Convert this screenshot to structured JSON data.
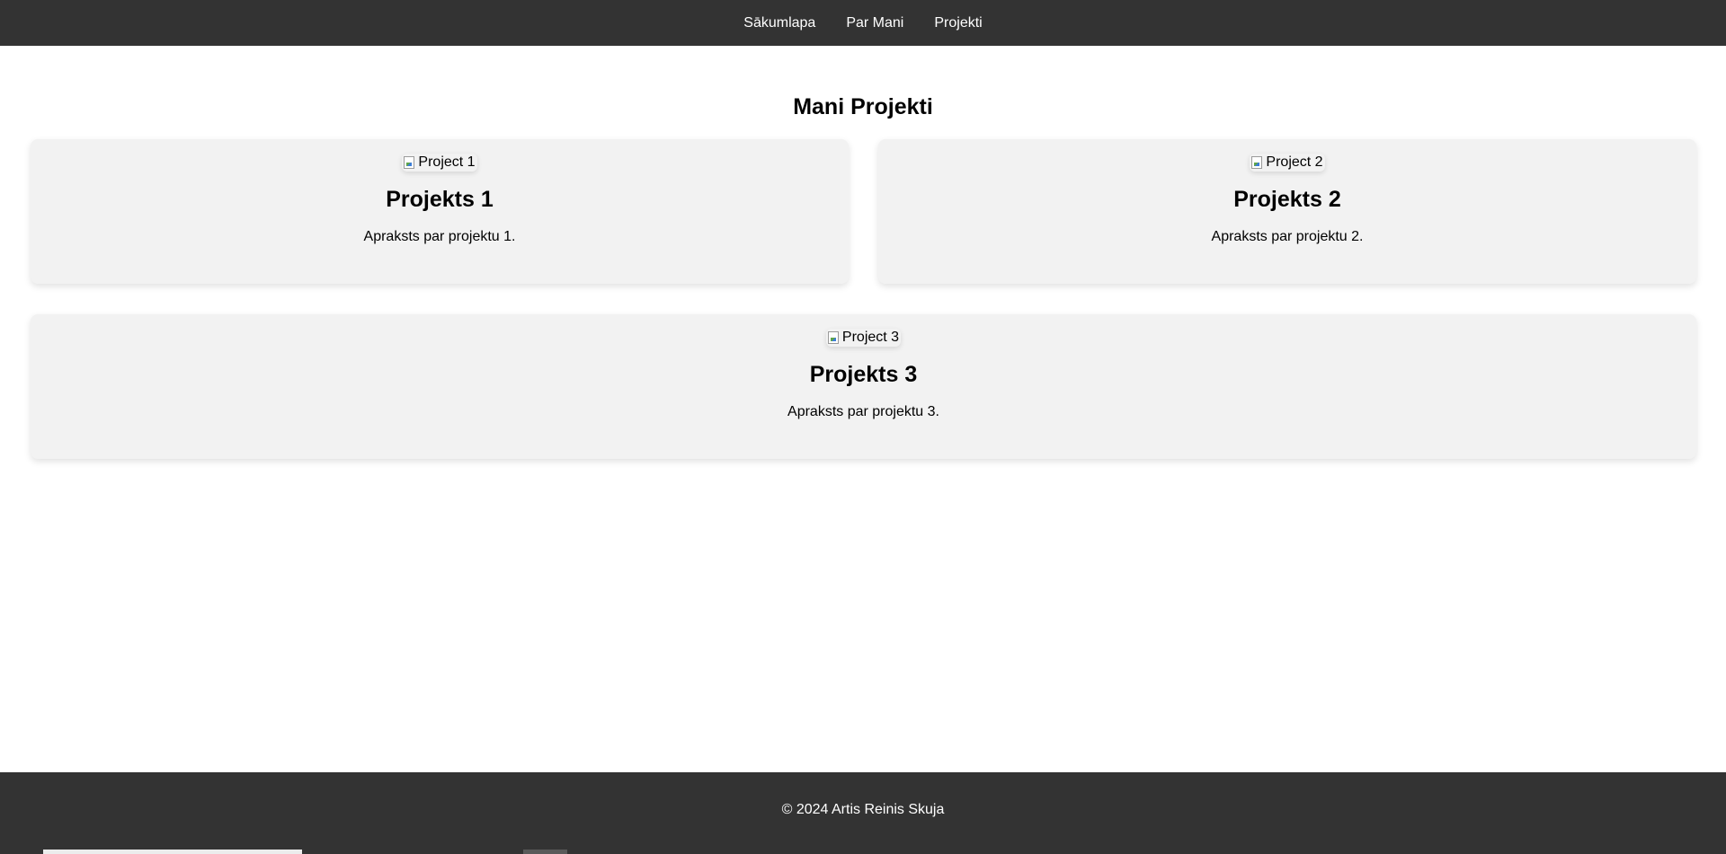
{
  "nav": {
    "items": [
      {
        "label": "Sākumlapa"
      },
      {
        "label": "Par Mani"
      },
      {
        "label": "Projekti"
      }
    ]
  },
  "main": {
    "title": "Mani Projekti",
    "projects": [
      {
        "image_alt": "Project 1",
        "title": "Projekts 1",
        "description": "Apraksts par projektu 1."
      },
      {
        "image_alt": "Project 2",
        "title": "Projekts 2",
        "description": "Apraksts par projektu 2."
      },
      {
        "image_alt": "Project 3",
        "title": "Projekts 3",
        "description": "Apraksts par projektu 3."
      }
    ]
  },
  "footer": {
    "text": "© 2024 Artis Reinis Skuja"
  },
  "colors": {
    "nav_background": "#333333",
    "card_background": "#f2f2f2",
    "footer_background": "#333333"
  }
}
